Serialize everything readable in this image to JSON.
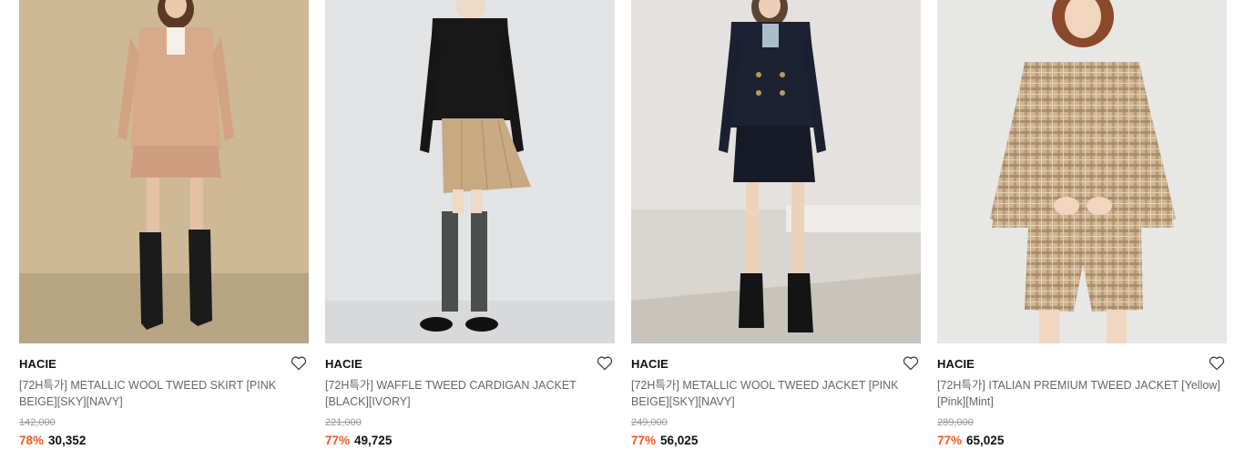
{
  "products": [
    {
      "brand": "HACIE",
      "title": "[72H특가] METALLIC WOOL TWEED SKIRT [PINK BEIGE][SKY][NAVY]",
      "original_price": "142,000",
      "discount": "78%",
      "price": "30,352",
      "colors": {
        "bg": "#d2bf9f",
        "outfit": "#d7a98a",
        "accent": "#1e1e1e"
      }
    },
    {
      "brand": "HACIE",
      "title": "[72H특가] WAFFLE TWEED CARDIGAN JACKET [BLACK][IVORY]",
      "original_price": "221,000",
      "discount": "77%",
      "price": "49,725",
      "colors": {
        "bg": "#e2e4e6",
        "outfit": "#1a1a1a",
        "accent": "#c9ad86"
      }
    },
    {
      "brand": "HACIE",
      "title": "[72H특가] METALLIC WOOL TWEED JACKET [PINK BEIGE][SKY][NAVY]",
      "original_price": "249,000",
      "discount": "77%",
      "price": "56,025",
      "colors": {
        "bg": "#e6e3e0",
        "outfit": "#1d2333",
        "accent": "#1a1a1a"
      }
    },
    {
      "brand": "HACIE",
      "title": "[72H특가] ITALIAN PREMIUM TWEED JACKET [Yellow][Pink][Mint]",
      "original_price": "289,000",
      "discount": "77%",
      "price": "65,025",
      "colors": {
        "bg": "#e8e8e6",
        "outfit": "#c9b08f",
        "accent": "#8a6a4c"
      }
    }
  ],
  "icons": {
    "wishlist": "heart-outline-icon"
  }
}
